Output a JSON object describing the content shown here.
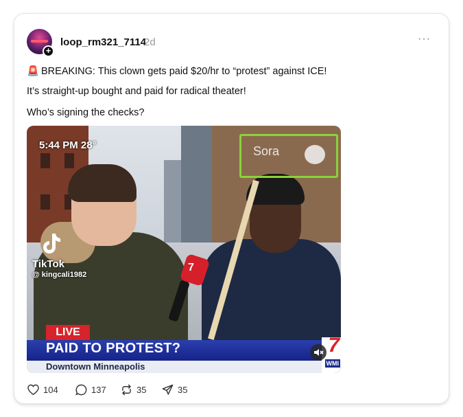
{
  "post": {
    "username": "loop_rm321_7114",
    "time": "2d",
    "more_label": "···",
    "line1": "BREAKING: This clown gets paid $20/hr to “protest” against ICE!",
    "line2": "It’s straight-up bought and paid for radical theater!",
    "line3": "Who’s signing the checks?",
    "siren_emoji": "🚨"
  },
  "media": {
    "osd_time": "5:44 PM  28°",
    "watermark": "Sora",
    "tiktok_name": "TikTok",
    "tiktok_user": "@ kingcali1982",
    "live": "LIVE",
    "headline": "PAID TO PROTEST?",
    "location": "Downtown Minneapolis",
    "mic_number": "7",
    "station_number": "7",
    "station_tag": "WMI",
    "highlight_color": "#8bd33a"
  },
  "actions": {
    "likes": "104",
    "comments": "137",
    "reposts": "35",
    "shares": "35"
  },
  "icons": [
    "heart-icon",
    "comment-icon",
    "repost-icon",
    "share-icon",
    "more-icon",
    "mute-icon"
  ]
}
